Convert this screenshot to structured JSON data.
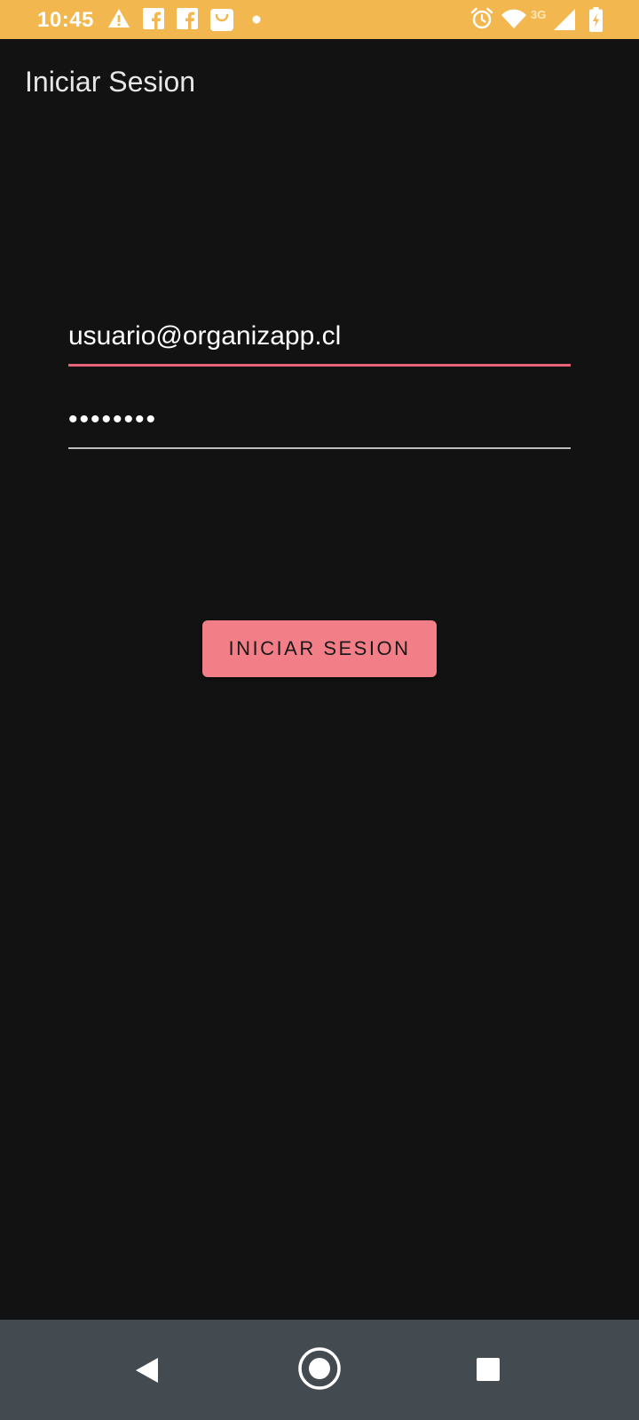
{
  "status_bar": {
    "time": "10:45",
    "network_label": "3G",
    "background_color": "#F3B74F",
    "icons": [
      "warning-icon",
      "facebook-icon",
      "facebook-icon",
      "shopping-bag-icon",
      "dot-icon",
      "alarm-icon",
      "wifi-icon",
      "signal-icon",
      "battery-charging-icon"
    ]
  },
  "app_bar": {
    "title": "Iniciar Sesion"
  },
  "login_form": {
    "email_value": "usuario@organizapp.cl",
    "password_value": "••••••••",
    "submit_label": "INICIAR SESION",
    "accent_color": "#E8637A",
    "button_color": "#F27F88"
  },
  "nav_bar": {
    "icons": [
      "back-icon",
      "home-icon",
      "recents-icon"
    ]
  }
}
